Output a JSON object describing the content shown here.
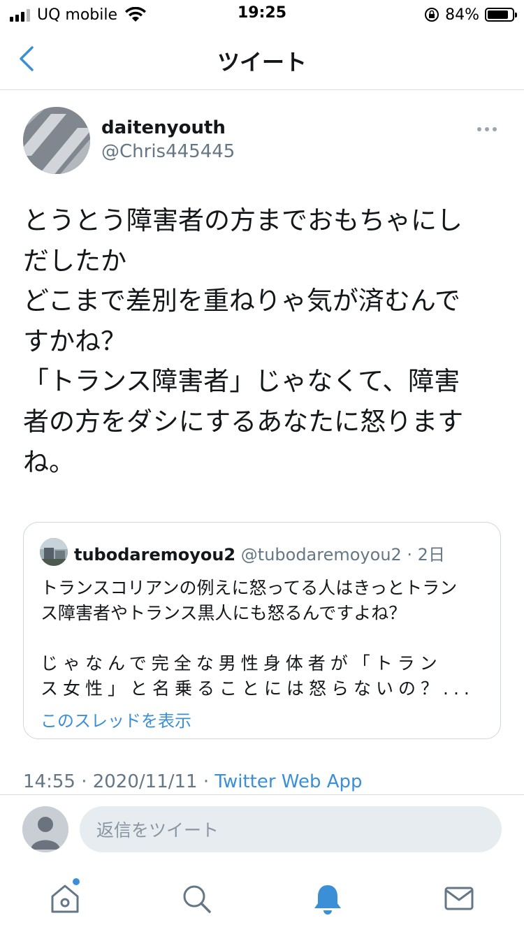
{
  "status_bar": {
    "carrier": "UQ mobile",
    "time": "19:25",
    "battery": "84%",
    "battery_level": 0.84
  },
  "header": {
    "title": "ツイート"
  },
  "tweet": {
    "author_name": "daitenyouth",
    "author_handle": "@Chris445445",
    "text_lines": [
      "とうとう障害者の方までおもちゃにし",
      "だしたか",
      "どこまで差別を重ねりゃ気が済むんで",
      "すかね？",
      "「トランス障害者」じゃなくて、障害",
      "者の方をダシにするあなたに怒ります",
      "ね。"
    ],
    "timestamp": "14:55 · 2020/11/11 · ",
    "source": "Twitter Web App"
  },
  "quoted_tweet": {
    "author_name": "tubodaremoyou2",
    "meta": "@tubodaremoyou2 · 2日",
    "text_lines": [
      "トランスコリアンの例えに怒ってる人はきっとトラン",
      "ス障害者やトランス黒人にも怒るんですよね？",
      "",
      "じゃなんで完全な男性身体者が「トラン",
      "ス女性」と名乗ることには怒らないの？..."
    ],
    "show_thread": "このスレッドを表示"
  },
  "reply": {
    "placeholder": "返信をツイート"
  },
  "tabs": {
    "home_has_notification": true,
    "active_tab": "notifications"
  },
  "colors": {
    "accent": "#3b8fd6",
    "secondary_text": "#657786",
    "border": "#d9dde0"
  }
}
